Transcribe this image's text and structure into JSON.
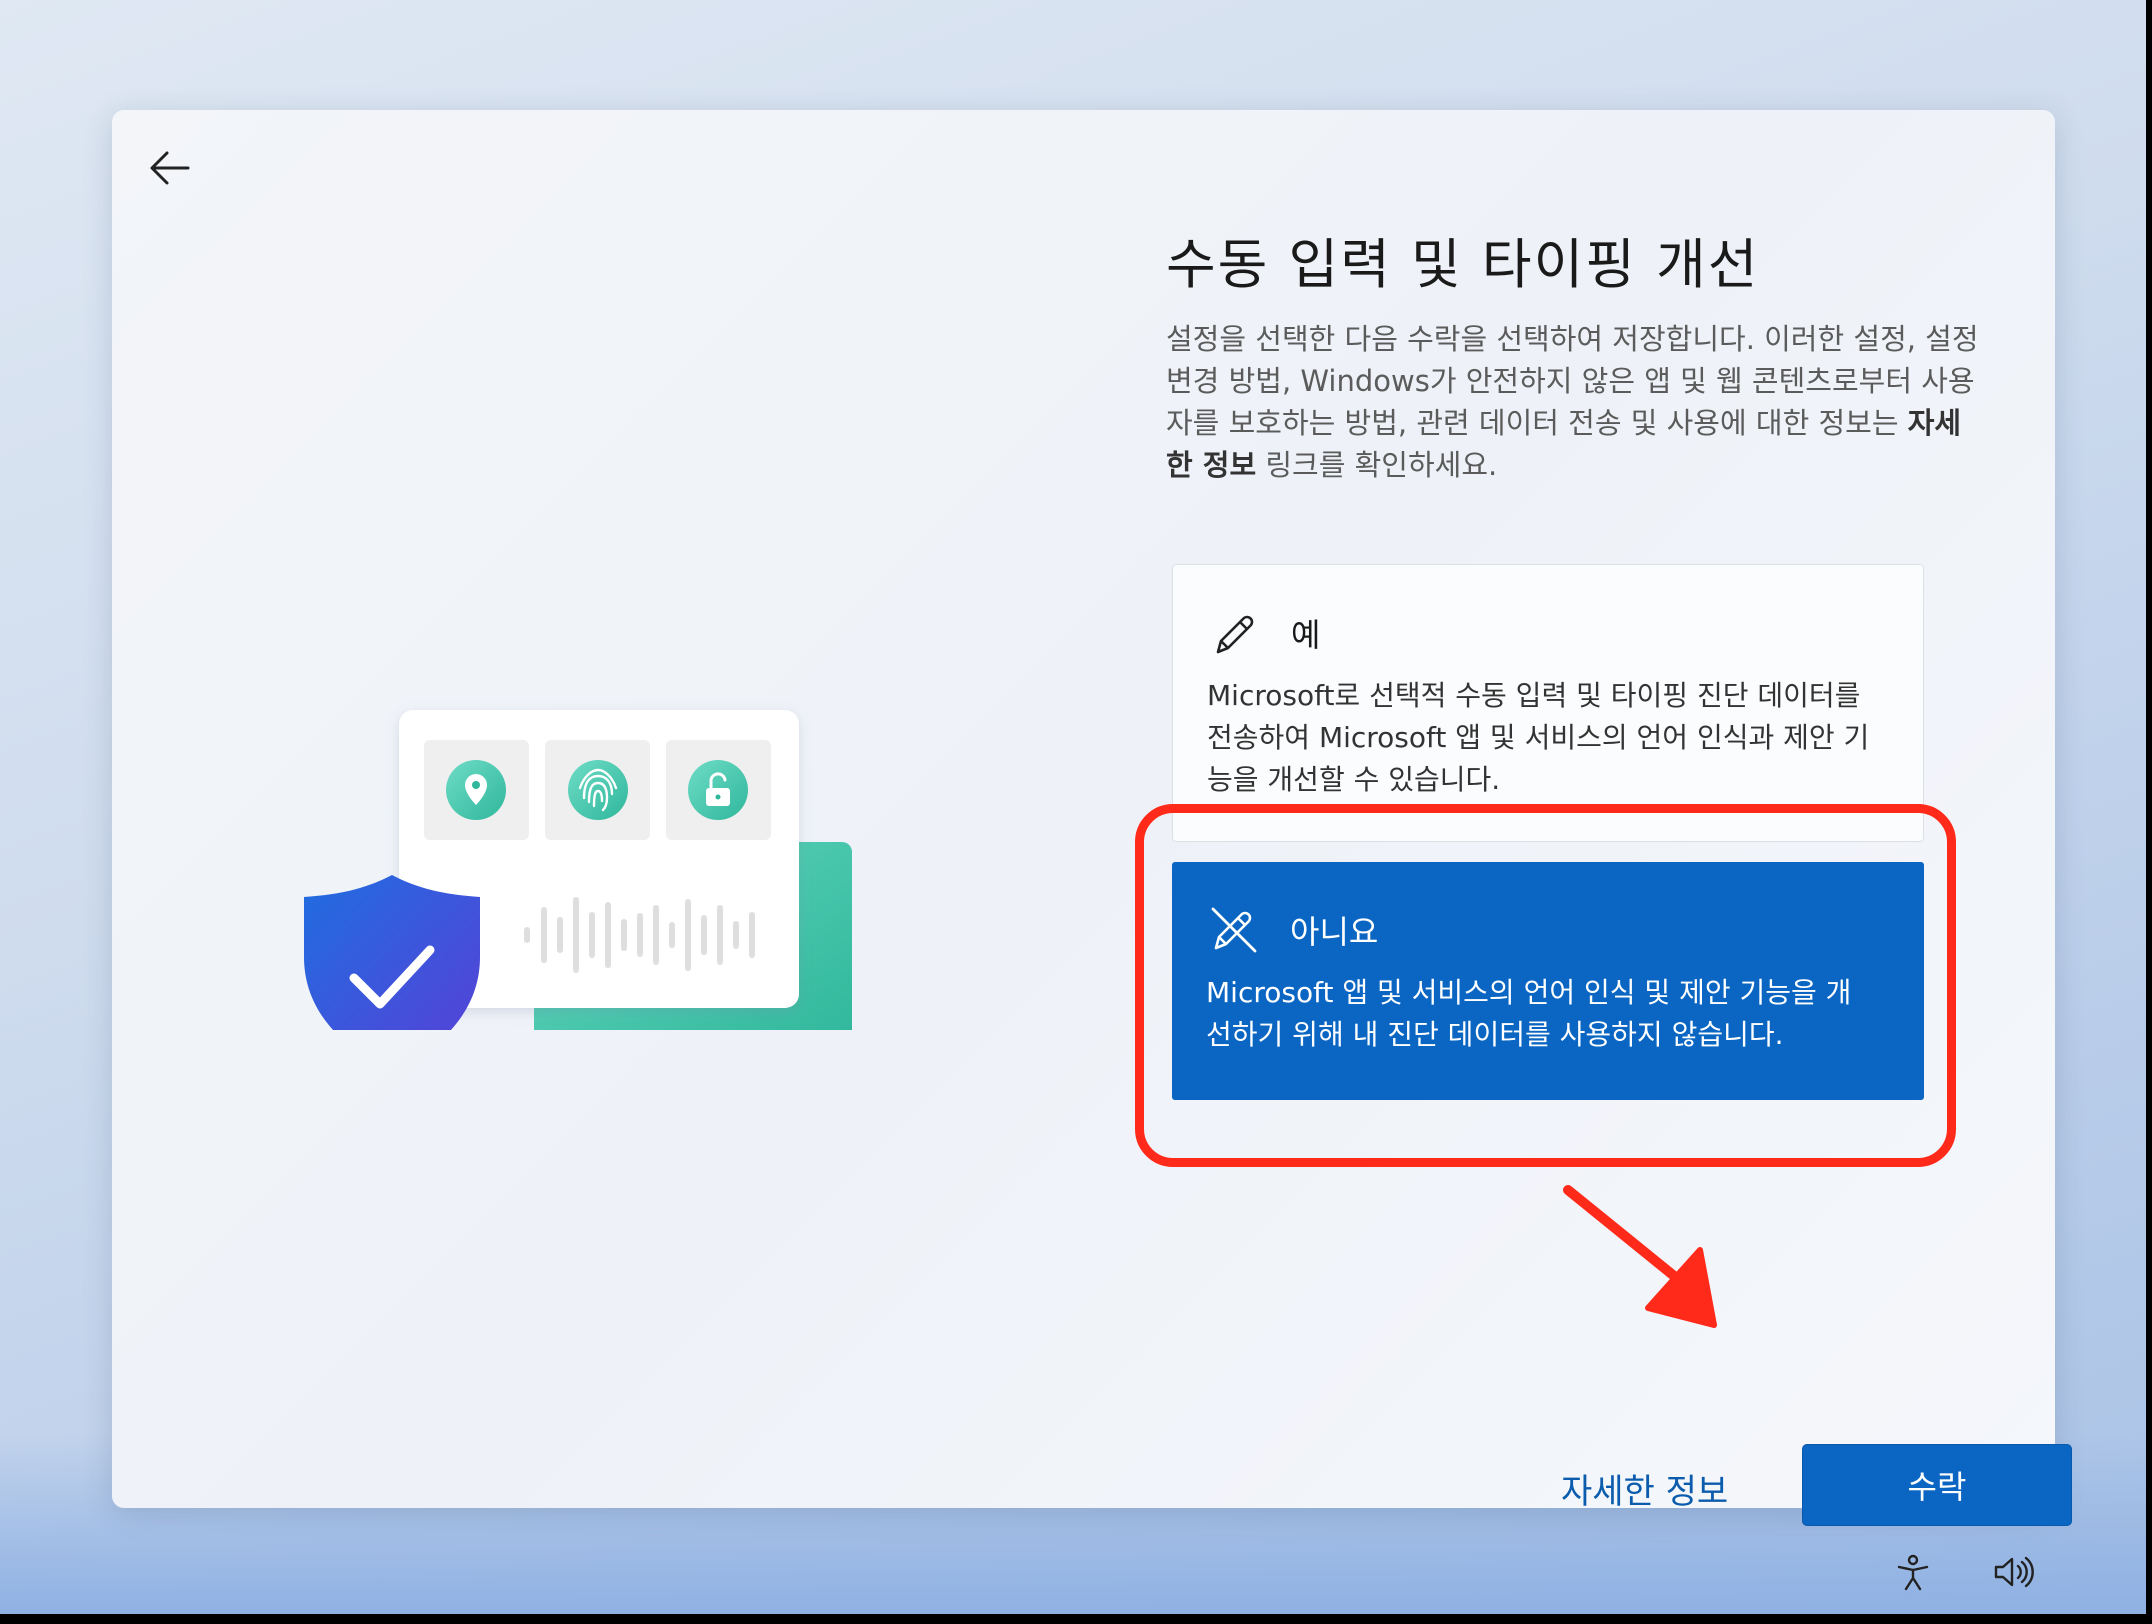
{
  "dialog": {
    "title": "수동 입력 및 타이핑 개선",
    "description_part1": "설정을 선택한 다음 수락을 선택하여 저장합니다. 이러한 설정, 설정 변경 방법, Windows가 안전하지 않은 앱 및 웹 콘텐츠로부터 사용자를 보호하는 방법, 관련 데이터 전송 및 사용에 대한 정보는 ",
    "description_bold": "자세한 정보",
    "description_part2": " 링크를 확인하세요."
  },
  "options": [
    {
      "label": "예",
      "icon": "pen-icon",
      "description": "Microsoft로 선택적 수동 입력 및 타이핑 진단 데이터를 전송하여 Microsoft 앱 및 서비스의 언어 인식과 제안 기능을 개선할 수 있습니다.",
      "selected": false
    },
    {
      "label": "아니요",
      "icon": "pen-off-icon",
      "description": "Microsoft 앱 및 서비스의 언어 인식 및 제안 기능을 개선하기 위해 내 진단 데이터를 사용하지 않습니다.",
      "selected": true
    }
  ],
  "footer": {
    "learn_more": "자세한 정보",
    "accept": "수락"
  },
  "colors": {
    "accent": "#0a66c2",
    "annotation": "#ff2a1a",
    "link": "#0b5cad"
  },
  "taskbar_icons": [
    "accessibility-icon",
    "volume-icon"
  ]
}
